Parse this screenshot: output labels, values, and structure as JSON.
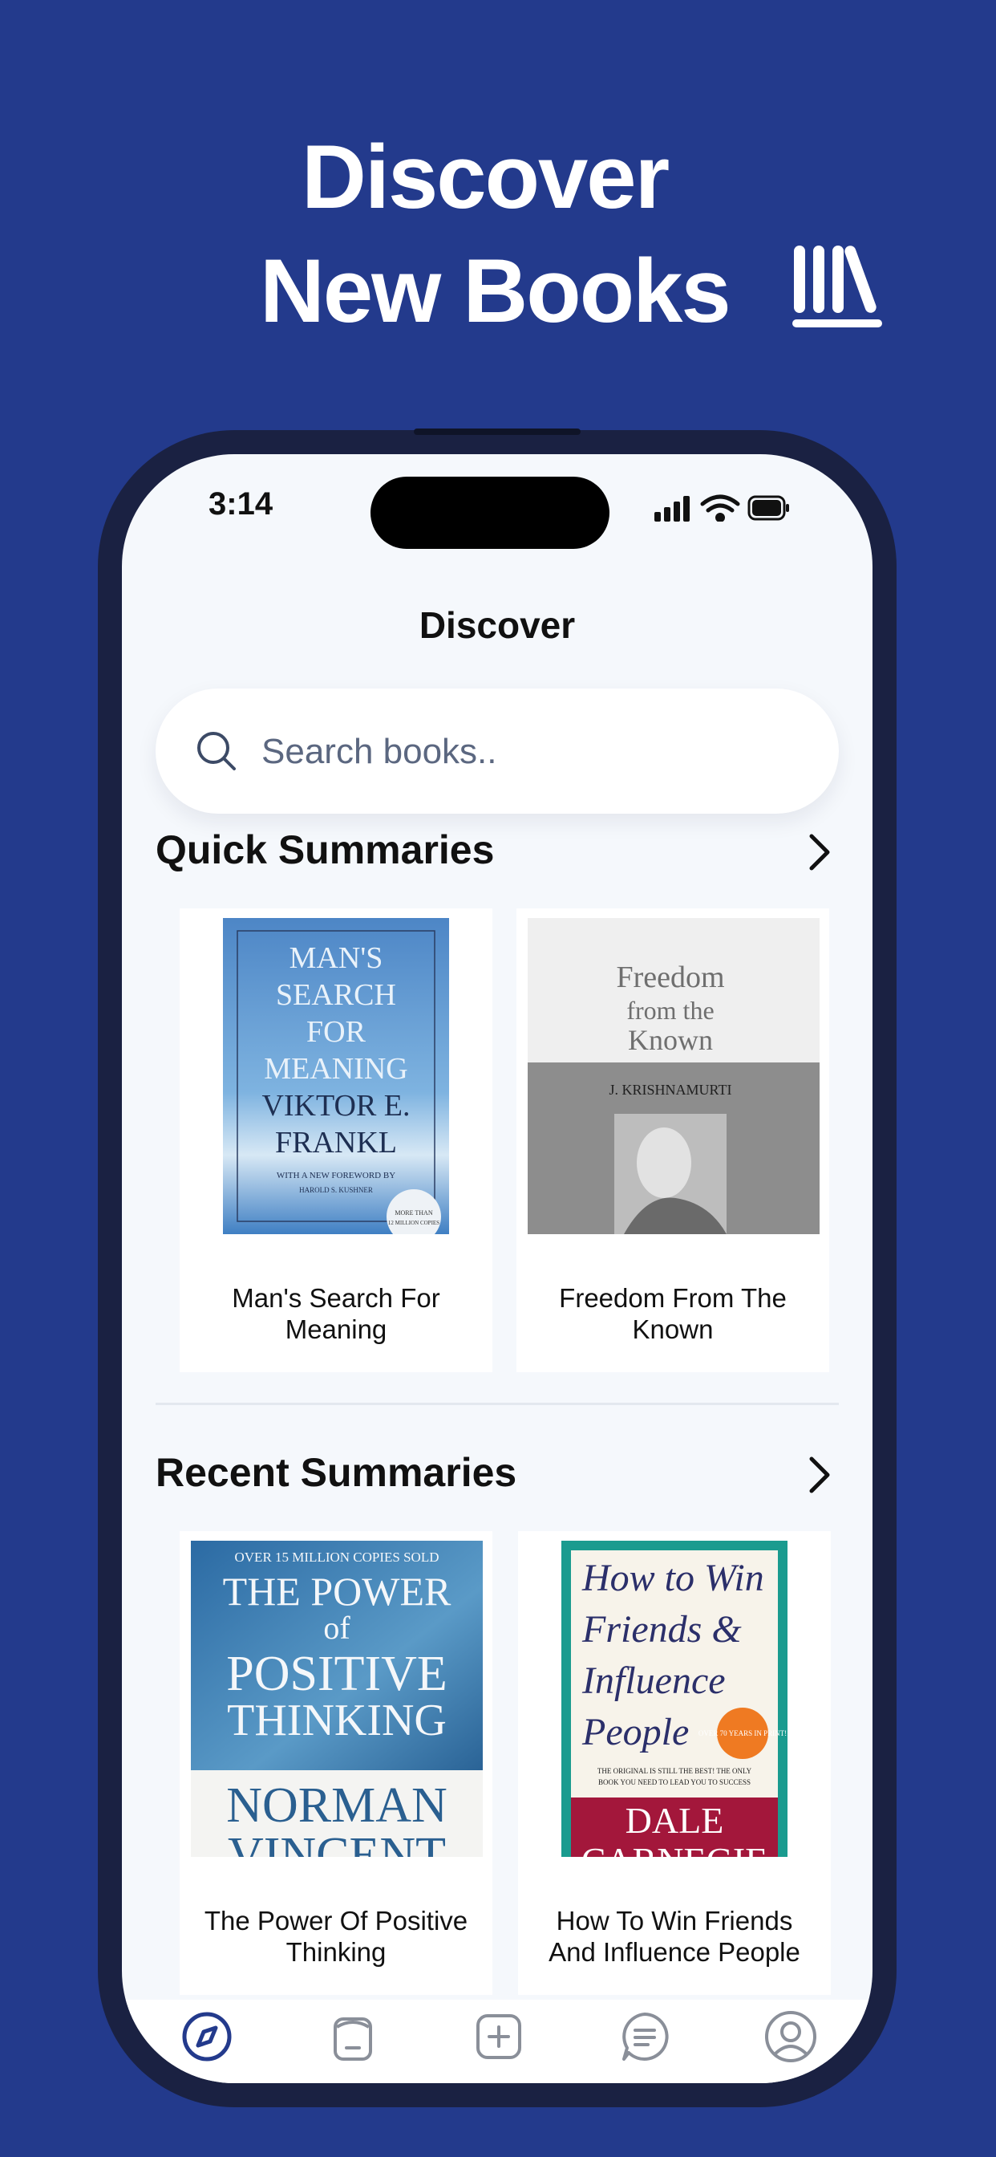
{
  "promo": {
    "headline_line1": "Discover",
    "headline_line2": "New Books",
    "icon": "books-shelf-icon",
    "background_color": "#233a8c"
  },
  "status_bar": {
    "time": "3:14",
    "icons": [
      "signal-icon",
      "wifi-icon",
      "battery-icon"
    ]
  },
  "page": {
    "title": "Discover"
  },
  "search": {
    "placeholder": "Search books..",
    "value": ""
  },
  "sections": [
    {
      "title": "Quick Summaries",
      "books": [
        {
          "caption_line1": "Man's Search For",
          "caption_line2": "Meaning",
          "cover_lines": [
            "MAN'S",
            "SEARCH",
            "FOR",
            "MEANING",
            "VIKTOR E.",
            "FRANKL"
          ],
          "cover_small": "WITH A NEW FOREWORD BY",
          "cover_small2": "HAROLD S. KUSHNER",
          "cover_badge": "MORE THAN",
          "cover_badge2": "12 MILLION COPIES"
        },
        {
          "caption_line1": "Freedom From The",
          "caption_line2": "Known",
          "cover_lines": [
            "Freedom",
            "from the",
            "Known"
          ],
          "cover_author": "J. KRISHNAMURTI"
        }
      ]
    },
    {
      "title": "Recent Summaries",
      "books": [
        {
          "caption_line1": "The Power Of Positive",
          "caption_line2": "Thinking",
          "cover_top": "OVER 15 MILLION COPIES SOLD",
          "cover_lines": [
            "THE POWER",
            "of",
            "POSITIVE",
            "THINKING"
          ],
          "cover_author_lines": [
            "NORMAN",
            "VINCENT"
          ]
        },
        {
          "caption_line1": "How To Win Friends",
          "caption_line2": "And Influence People",
          "cover_lines": [
            "How to Win",
            "Friends &",
            "Influence",
            "People"
          ],
          "cover_badge": "OVER 70 YEARS IN PRINT!",
          "cover_small": "THE ORIGINAL IS STILL THE BEST! THE ONLY",
          "cover_small2": "BOOK YOU NEED TO LEAD YOU TO SUCCESS",
          "cover_author_lines": [
            "DALE",
            "CARNEGIE"
          ]
        }
      ]
    }
  ],
  "tab_bar": {
    "tabs": [
      {
        "icon": "compass-icon",
        "active": true
      },
      {
        "icon": "library-icon",
        "active": false
      },
      {
        "icon": "add-icon",
        "active": false
      },
      {
        "icon": "chat-icon",
        "active": false
      },
      {
        "icon": "profile-icon",
        "active": false
      }
    ],
    "active_color": "#233a8c",
    "inactive_color": "#8a8f99"
  }
}
